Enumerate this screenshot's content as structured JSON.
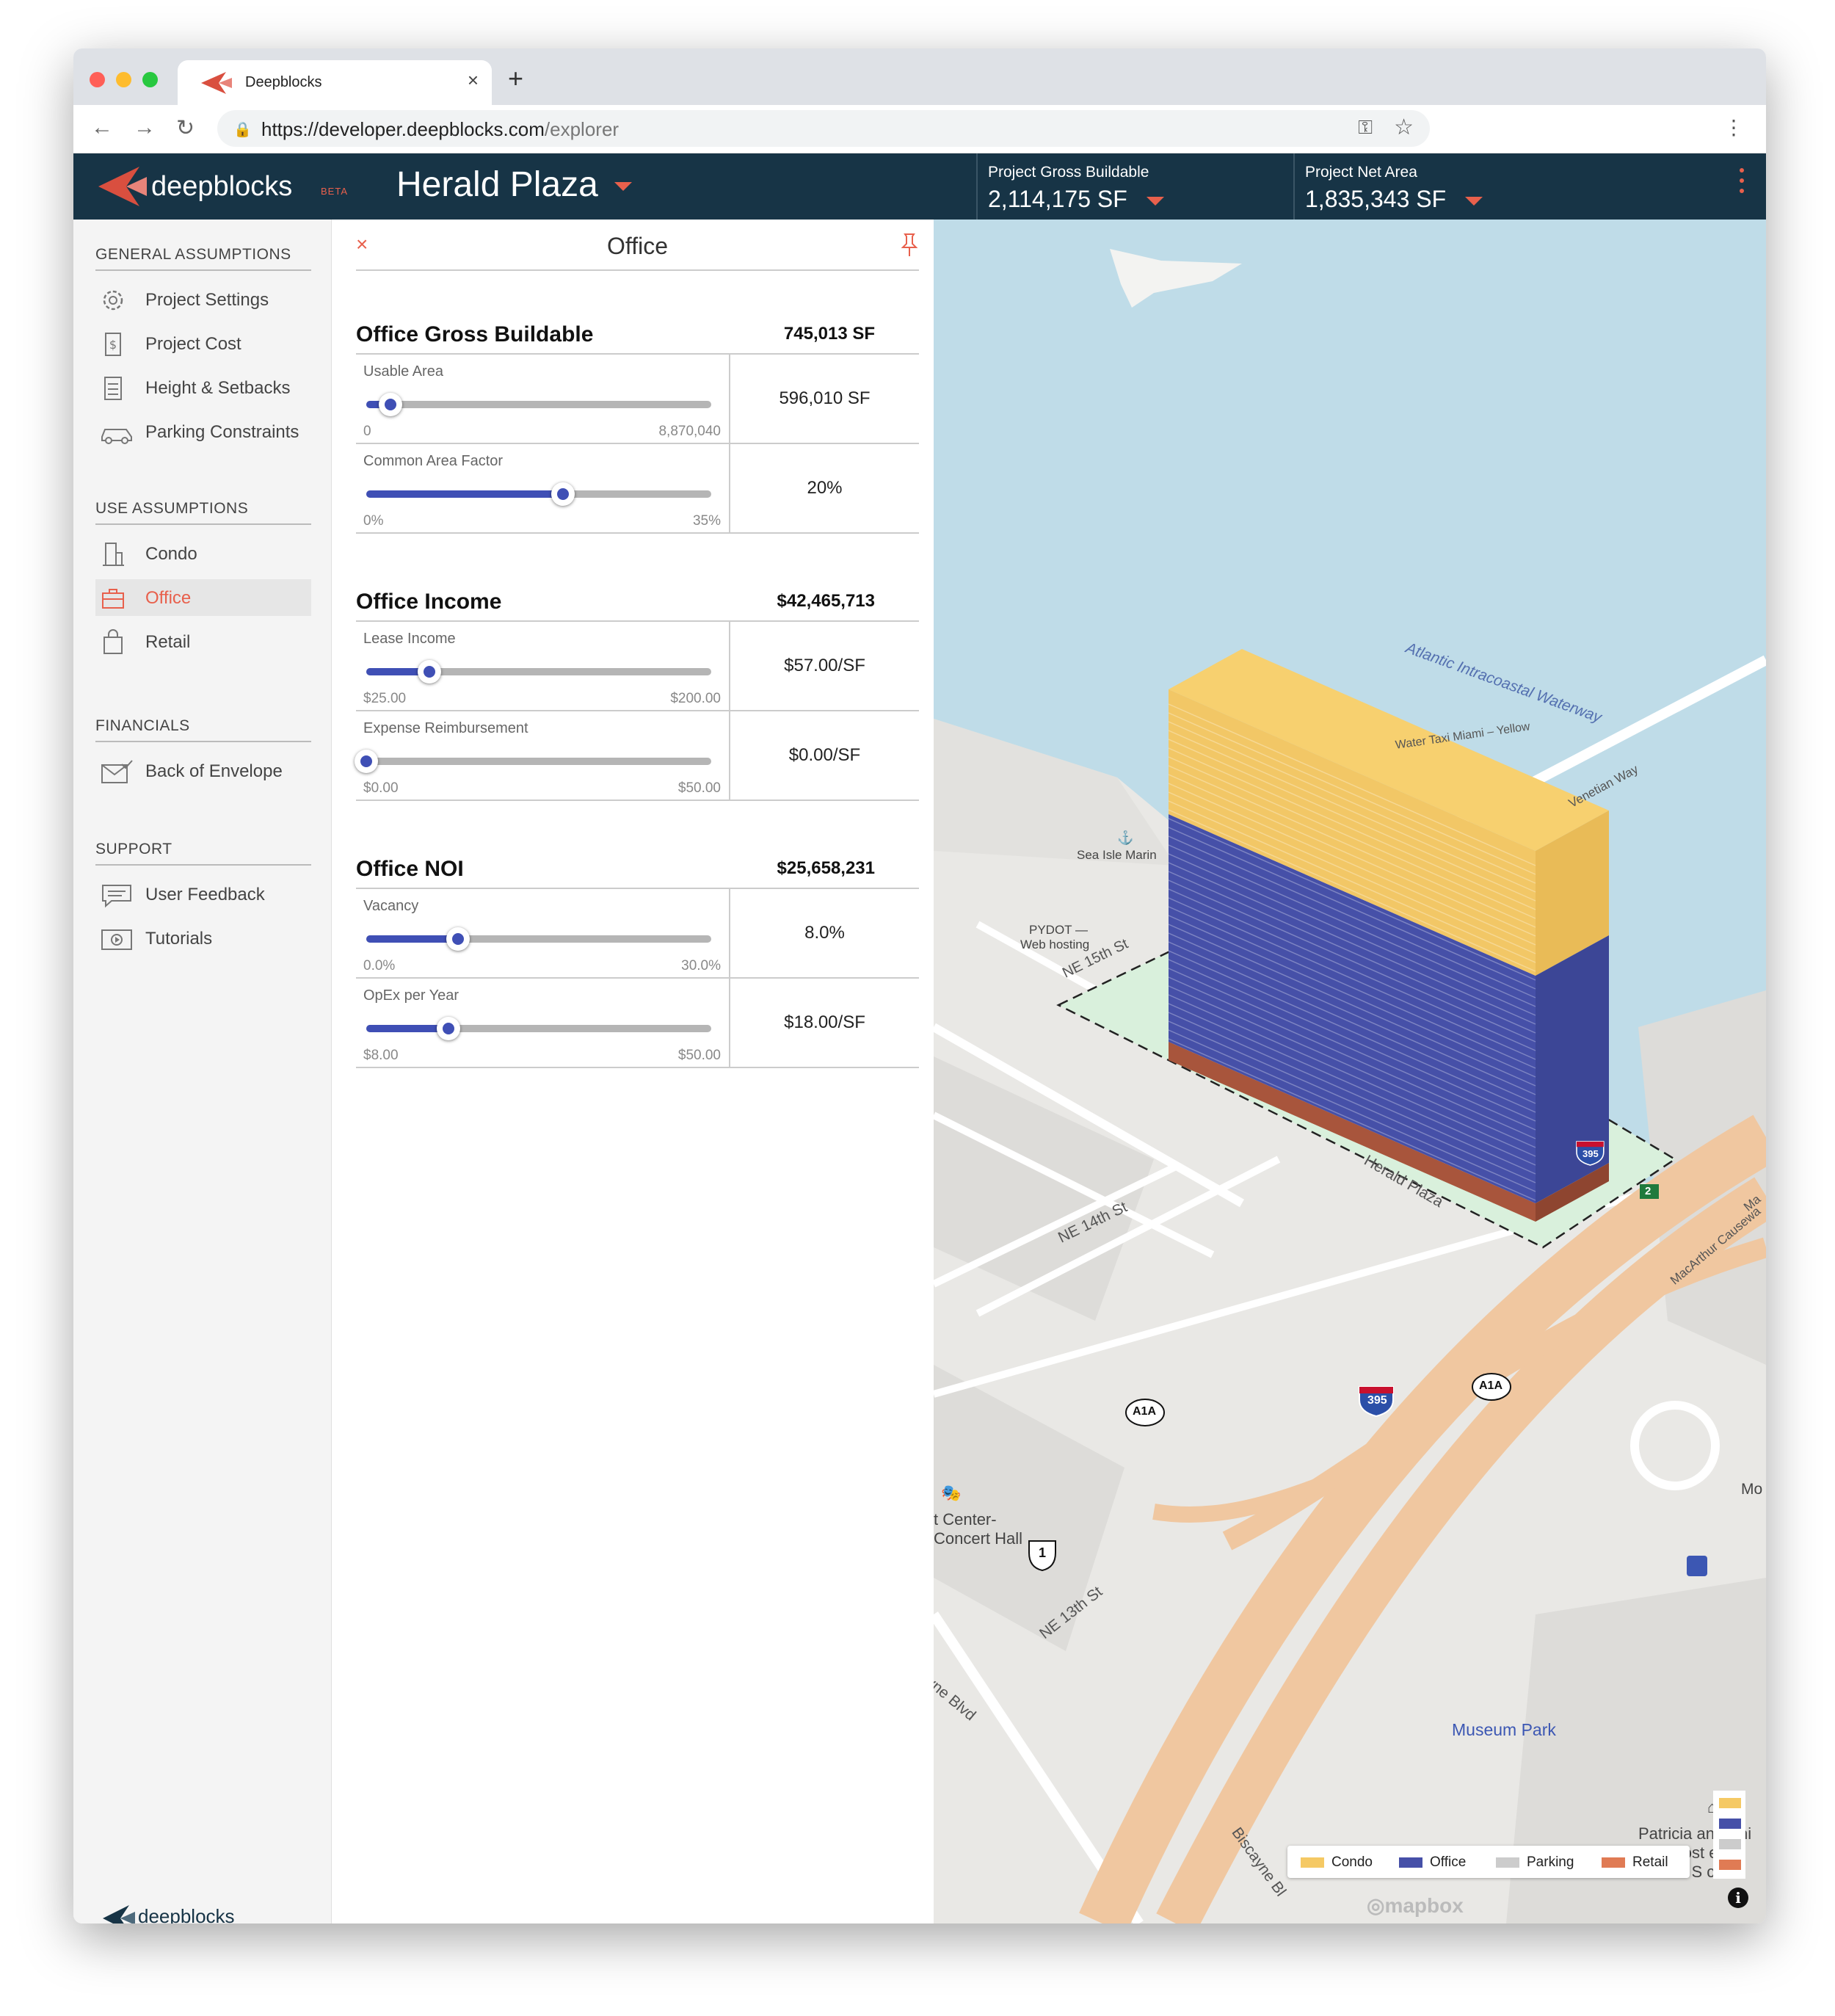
{
  "browser": {
    "tab_title": "Deepblocks",
    "tab_close": "×",
    "new_tab": "+",
    "url_base": "https://developer.deepblocks.com",
    "url_path": "/explorer"
  },
  "app": {
    "logo_text": "deepblocks",
    "beta": "BETA",
    "project_name": "Herald Plaza",
    "metrics": [
      {
        "label": "Project Gross Buildable",
        "value": "2,114,175 SF"
      },
      {
        "label": "Project Net Area",
        "value": "1,835,343 SF"
      }
    ],
    "accent": "#e8604c",
    "header_bg": "#173446"
  },
  "sidebar": {
    "sections": [
      {
        "title": "GENERAL ASSUMPTIONS",
        "items": [
          {
            "label": "Project Settings",
            "icon": "gear-icon"
          },
          {
            "label": "Project Cost",
            "icon": "dollar-receipt-icon"
          },
          {
            "label": "Height & Setbacks",
            "icon": "sliders-icon"
          },
          {
            "label": "Parking Constraints",
            "icon": "car-icon"
          }
        ]
      },
      {
        "title": "USE ASSUMPTIONS",
        "items": [
          {
            "label": "Condo",
            "icon": "building-icon"
          },
          {
            "label": "Office",
            "icon": "briefcase-icon",
            "active": true
          },
          {
            "label": "Retail",
            "icon": "shopping-bag-icon"
          }
        ]
      },
      {
        "title": "FINANCIALS",
        "items": [
          {
            "label": "Back of Envelope",
            "icon": "envelope-check-icon"
          }
        ]
      },
      {
        "title": "SUPPORT",
        "items": [
          {
            "label": "User Feedback",
            "icon": "chat-icon"
          },
          {
            "label": "Tutorials",
            "icon": "video-icon"
          }
        ]
      }
    ],
    "footer_logo": "deepblocks"
  },
  "panel": {
    "title": "Office",
    "close": "×",
    "sections": [
      {
        "title": "Office Gross Buildable",
        "total": "745,013 SF",
        "rows": [
          {
            "label": "Usable Area",
            "value": "596,010 SF",
            "min": "0",
            "max": "8,870,040",
            "fraction": 0.07,
            "fill_start": 0.0
          },
          {
            "label": "Common Area Factor",
            "value": "20%",
            "min": "0%",
            "max": "35%",
            "fraction": 0.571
          }
        ]
      },
      {
        "title": "Office Income",
        "total": "$42,465,713",
        "rows": [
          {
            "label": "Lease Income",
            "value": "$57.00/SF",
            "min": "$25.00",
            "max": "$200.00",
            "fraction": 0.183
          },
          {
            "label": "Expense Reimbursement",
            "value": "$0.00/SF",
            "min": "$0.00",
            "max": "$50.00",
            "fraction": 0.0
          }
        ]
      },
      {
        "title": "Office NOI",
        "total": "$25,658,231",
        "rows": [
          {
            "label": "Vacancy",
            "value": "8.0%",
            "min": "0.0%",
            "max": "30.0%",
            "fraction": 0.267
          },
          {
            "label": "OpEx per Year",
            "value": "$18.00/SF",
            "min": "$8.00",
            "max": "$50.00",
            "fraction": 0.238
          }
        ]
      }
    ]
  },
  "map": {
    "labels": {
      "waterway": "Atlantic Intracoastal Waterway",
      "water_taxi": "Water Taxi Miami – Yellow",
      "venetian": "Venetian Way",
      "marina": "Sea Isle Marin",
      "pydot": "PYDOT —",
      "pydot2": "Web hosting",
      "ne15": "NE 15th St",
      "ne14": "NE 14th St",
      "ne13": "NE 13th St",
      "herald": "Herald Plaza",
      "macarthur": "MacArthur Causewa",
      "ma": "Ma",
      "mo": "Mo",
      "center1": "t Center-",
      "center2": "Concert Hall",
      "biscayne": "Biscayne Bl",
      "ne_blvd": "vne Blvd",
      "museum_park": "Museum Park",
      "frost1": "Patricia and Phi",
      "frost2": "Frost  eur",
      "frost3": "of S    ce",
      "shield_395": "395",
      "shield_a1a": "A1A",
      "shield_1": "1",
      "shield_2": "2",
      "mapbox": "mapbox",
      "info": "i"
    },
    "legend": [
      {
        "label": "Condo",
        "color": "#f5c964"
      },
      {
        "label": "Office",
        "color": "#4650a8"
      },
      {
        "label": "Parking",
        "color": "#cccccc"
      },
      {
        "label": "Retail",
        "color": "#e07b54"
      }
    ]
  }
}
